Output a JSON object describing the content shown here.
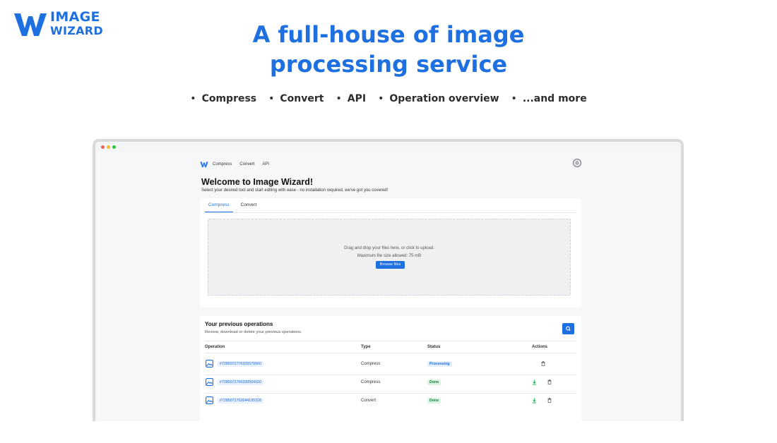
{
  "brand": {
    "line1": "IMAGE",
    "line2": "WIZARD",
    "color": "#1e6fe0"
  },
  "hero": {
    "line1": "A full-house of image",
    "line2": "processing service"
  },
  "features": [
    "Compress",
    "Convert",
    "API",
    "Operation overview",
    "...and more"
  ],
  "browser_dots": [
    "#ee5f57",
    "#f5bd2e",
    "#28c840"
  ],
  "app": {
    "nav": {
      "links": [
        "Compress",
        "Convert",
        "API"
      ],
      "avatar": "G"
    },
    "welcome_title": "Welcome to Image Wizard!",
    "welcome_subtitle": "Select your desired tool and start editing with ease - no installation required, we've got you covered!",
    "tabs": [
      {
        "label": "Compress",
        "active": true
      },
      {
        "label": "Convert",
        "active": false
      }
    ],
    "dropzone": {
      "line1": "Drag and drop your files here, or click to upload.",
      "line2": "Maximum file size allowed: 75 mB",
      "browse_label": "Browse files"
    },
    "operations": {
      "title": "Your previous operations",
      "subtitle": "Review, download or delete your previous operations.",
      "columns": [
        "Operation",
        "Type",
        "Status",
        "Actions"
      ],
      "rows": [
        {
          "id": "#7285072776325570560",
          "type": "Compress",
          "status": "Processing",
          "download": false
        },
        {
          "id": "#7285072766200504320",
          "type": "Compress",
          "status": "Done",
          "download": true
        },
        {
          "id": "#7285072702644195328",
          "type": "Convert",
          "status": "Done",
          "download": true
        }
      ]
    }
  }
}
